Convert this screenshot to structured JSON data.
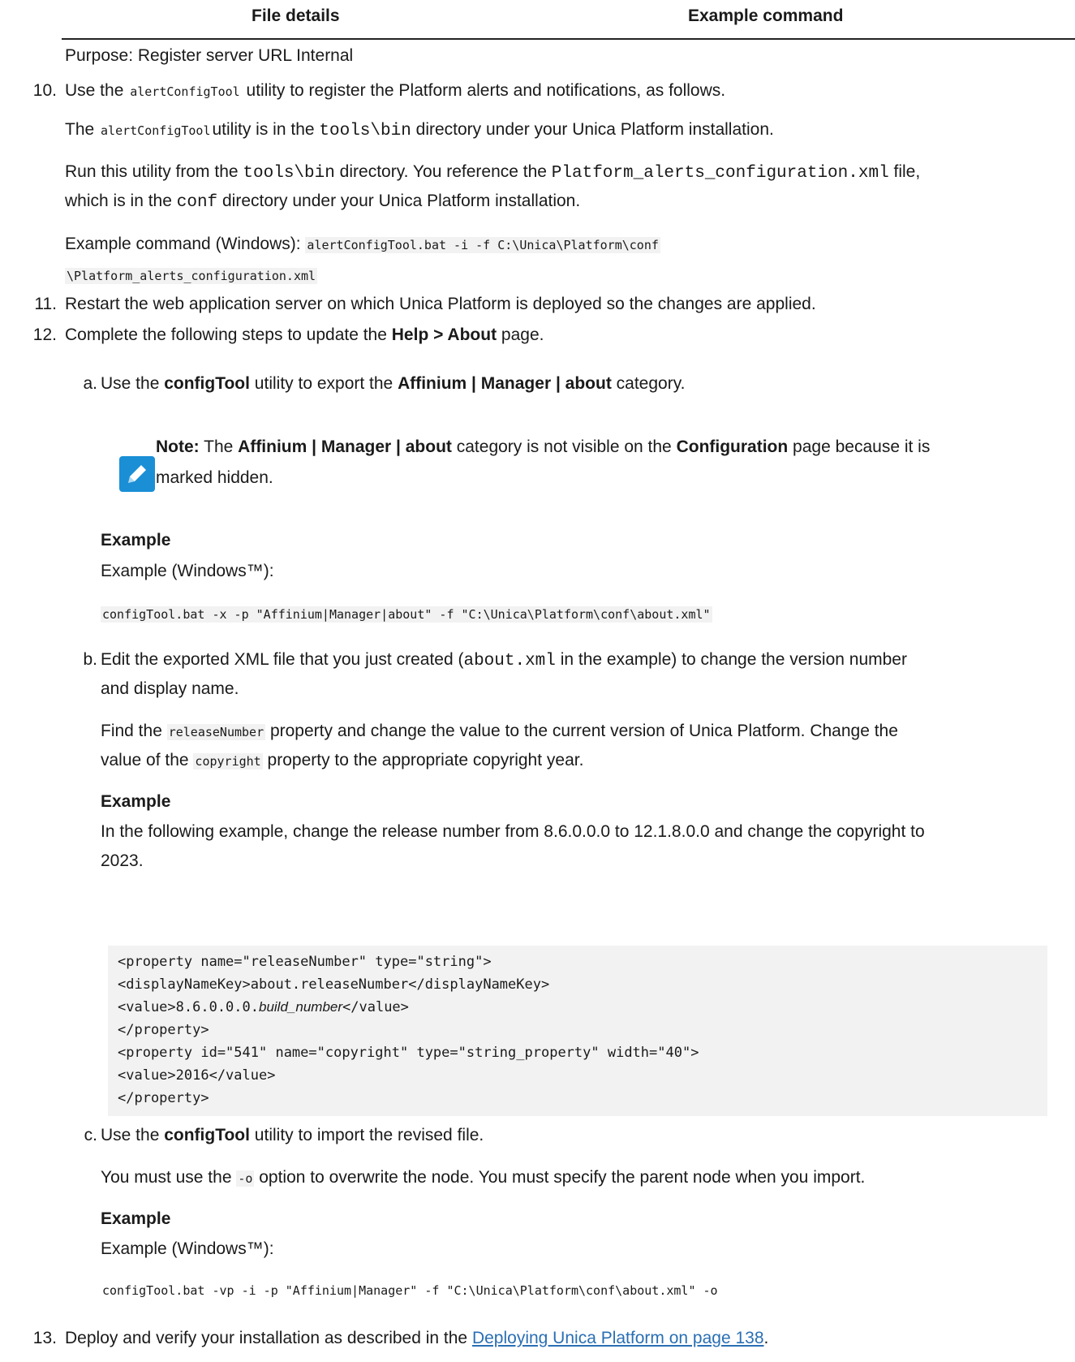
{
  "table": {
    "headers": [
      "File details",
      "Example command"
    ],
    "purpose": "Purpose: Register server URL Internal"
  },
  "step10": {
    "num": "10.",
    "p1": [
      "Use the ",
      "alertConfigTool",
      " utility to register the Platform alerts and notifications, as follows."
    ],
    "p2": [
      "The ",
      "alertConfigTool",
      "utility is in the ",
      "tools\\bin",
      " directory under your Unica Platform installation."
    ],
    "p3": [
      "Run this utility from the ",
      "tools\\bin",
      " directory. You reference the ",
      "Platform_alerts_configuration.xml",
      " file,"
    ],
    "p3b": [
      "which is in the ",
      "conf",
      " directory under your Unica Platform installation."
    ],
    "p4": [
      "Example command (Windows): ",
      "alertConfigTool.bat -i -f C:\\Unica\\Platform\\conf",
      "\\Platform_alerts_configuration.xml"
    ]
  },
  "step11": {
    "num": "11.",
    "text": "Restart the web application server on which Unica Platform is deployed so the changes are applied."
  },
  "step12": {
    "num": "12.",
    "text": [
      "Complete the following steps to update the ",
      "Help > About",
      " page."
    ],
    "a": {
      "letter": "a.",
      "text": [
        "Use the ",
        "configTool",
        " utility to export the ",
        "Affinium | Manager | about",
        " category."
      ],
      "note": [
        "Note:",
        " The ",
        "Affinium | Manager | about",
        " category is not visible on the ",
        "Configuration",
        " page because it is",
        "marked hidden."
      ],
      "example_heading": "Example",
      "example_label": "Example (Windows™):",
      "command": "configTool.bat -x -p \"Affinium|Manager|about\" -f \"C:\\Unica\\Platform\\conf\\about.xml\""
    },
    "b": {
      "letter": "b.",
      "text": [
        "Edit the exported XML file that you just created (",
        "about.xml",
        " in the example) to change the version number",
        "and display name."
      ],
      "p2": [
        "Find the ",
        "releaseNumber",
        " property and change the value to the current version of Unica Platform. Change the",
        "value of the ",
        "copyright",
        " property to the appropriate copyright year."
      ],
      "example_heading": "Example",
      "example_text": [
        "In the following example, change the release number from 8.6.0.0.0 to 12.1.8.0.0 and change the copyright to",
        "2023."
      ],
      "code": [
        "<property name=\"releaseNumber\" type=\"string\">",
        "<displayNameKey>about.releaseNumber</displayNameKey>",
        "<value>8.6.0.0.0.",
        "build_number",
        "</value>",
        "</property>",
        "<property id=\"541\" name=\"copyright\" type=\"string_property\" width=\"40\">",
        "<value>2016</value>",
        "</property>"
      ]
    },
    "c": {
      "letter": "c.",
      "text": [
        "Use the ",
        "configTool",
        " utility to import the revised file."
      ],
      "p2": [
        "You must use the ",
        "-o",
        " option to overwrite the node. You must specify the parent node when you import."
      ],
      "example_heading": "Example",
      "example_label": "Example (Windows™):",
      "command": "configTool.bat -vp -i -p \"Affinium|Manager\" -f \"C:\\Unica\\Platform\\conf\\about.xml\" -o"
    }
  },
  "step13": {
    "num": "13.",
    "text": [
      "Deploy and verify your installation as described in the ",
      "Deploying Unica Platform on page 138",
      "."
    ]
  },
  "colors": {
    "link": "#2a6fb3",
    "note_icon": "#1a8fd6"
  }
}
